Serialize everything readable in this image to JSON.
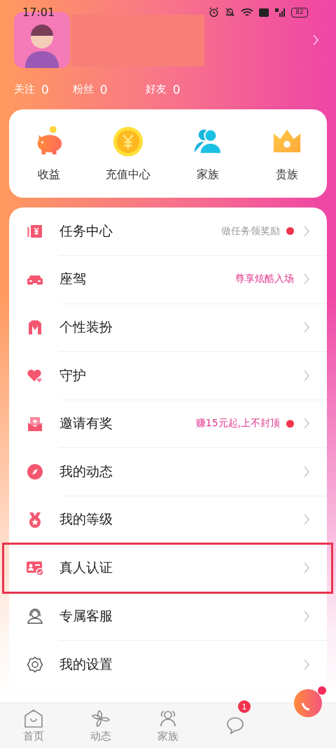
{
  "status_bar": {
    "time": "17:01",
    "battery": "82"
  },
  "profile": {
    "stats": [
      {
        "label": "关注",
        "value": "0"
      },
      {
        "label": "粉丝",
        "value": "0"
      },
      {
        "label": "好友",
        "value": "0"
      }
    ]
  },
  "shortcuts": [
    {
      "label": "收益"
    },
    {
      "label": "充值中心"
    },
    {
      "label": "家族"
    },
    {
      "label": "贵族"
    }
  ],
  "menu": [
    {
      "label": "任务中心",
      "hint": "做任务领奖励",
      "hint_accent": false,
      "dot": true,
      "highlighted": false
    },
    {
      "label": "座驾",
      "hint": "尊享炫酷入场",
      "hint_accent": true,
      "dot": false,
      "highlighted": false
    },
    {
      "label": "个性装扮",
      "dot": false,
      "highlighted": false
    },
    {
      "label": "守护",
      "dot": false,
      "highlighted": false
    },
    {
      "label": "邀请有奖",
      "hint": "赚15元起,上不封顶",
      "hint_accent": true,
      "dot": true,
      "highlighted": false
    },
    {
      "label": "我的动态",
      "dot": false,
      "highlighted": false
    },
    {
      "label": "我的等级",
      "dot": false,
      "highlighted": false
    },
    {
      "label": "真人认证",
      "dot": false,
      "highlighted": true
    },
    {
      "label": "专属客服",
      "dot": false,
      "highlighted": false
    },
    {
      "label": "我的设置",
      "dot": false,
      "highlighted": false
    }
  ],
  "tab_bar": [
    {
      "label": "首页",
      "selected": false
    },
    {
      "label": "动态",
      "selected": false
    },
    {
      "label": "家族",
      "selected": false
    },
    {
      "badge": "1",
      "selected": false
    }
  ]
}
